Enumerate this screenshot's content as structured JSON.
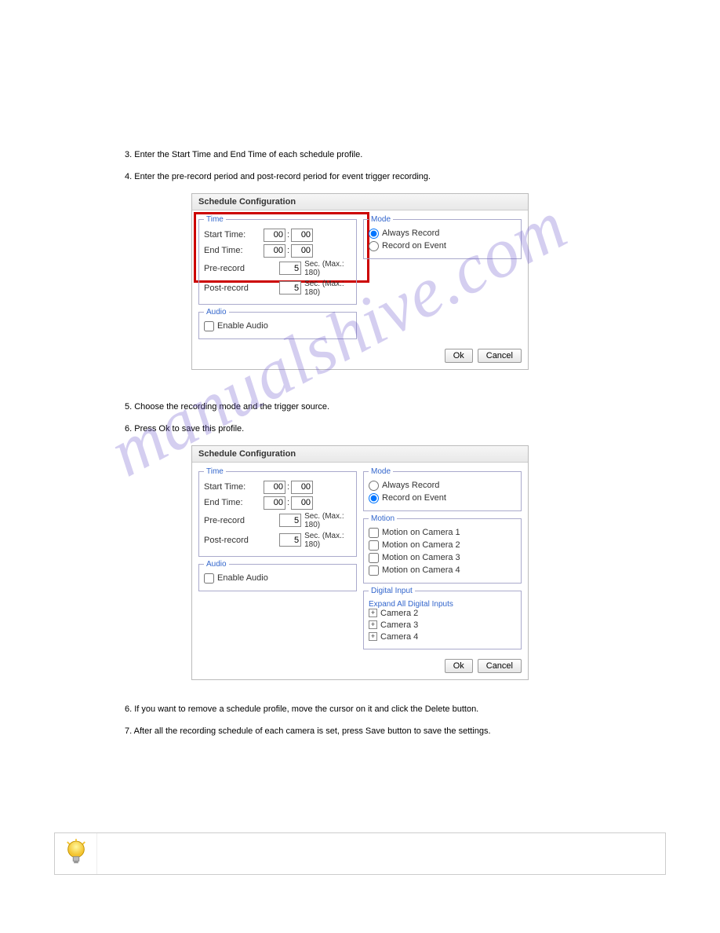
{
  "dialog": {
    "title": "Schedule Configuration",
    "time": {
      "legend": "Time",
      "start_label": "Start Time:",
      "end_label": "End Time:",
      "pre_label": "Pre-record",
      "post_label": "Post-record",
      "start_h": "00",
      "start_m": "00",
      "end_h": "00",
      "end_m": "00",
      "pre_val": "5",
      "post_val": "5",
      "sec_suffix": "Sec. (Max.: 180)"
    },
    "audio": {
      "legend": "Audio",
      "enable_label": "Enable Audio"
    },
    "mode": {
      "legend": "Mode",
      "always_label": "Always Record",
      "event_label": "Record on Event"
    },
    "motion": {
      "legend": "Motion",
      "items": [
        "Motion on Camera 1",
        "Motion on Camera 2",
        "Motion on Camera 3",
        "Motion on Camera 4"
      ]
    },
    "digital": {
      "legend": "Digital Input",
      "expand_label": "Expand All Digital Inputs",
      "items": [
        "Camera 2",
        "Camera 3",
        "Camera 4"
      ]
    },
    "ok_label": "Ok",
    "cancel_label": "Cancel"
  },
  "text": {
    "intro1": "3. Enter the Start Time and End Time of each schedule profile.",
    "intro2": "4. Enter the pre-record period and post-record period for event trigger recording.",
    "intro3_a": "5. Choose the recording mode and the trigger source.",
    "intro3_b": "6. Press Ok to save this profile.",
    "sec6_a": "6. If you want to remove a schedule profile, move the cursor on it and click the Delete button.",
    "sec7": "7. After all the recording schedule of each camera is set, press Save button to save the settings.",
    "watermark": "manualshive.com"
  }
}
